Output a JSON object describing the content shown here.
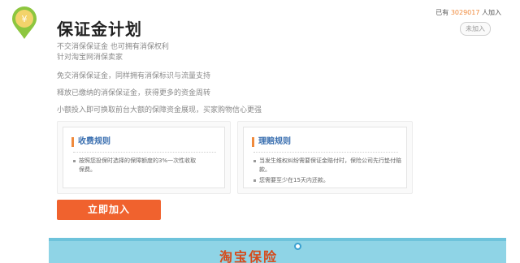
{
  "header": {
    "logo_symbol": "¥",
    "title": "保证金计划",
    "subtitle_lines": [
      "不交消保保证金 也可拥有消保权利",
      "针对淘宝网消保卖家"
    ],
    "join_count_prefix": "已有",
    "join_count": "3029017",
    "join_count_suffix": "人加入",
    "join_small_button": "未加入"
  },
  "benefits": [
    "免交消保保证金，同样拥有消保标识与流量支持",
    "释放已缴纳的消保保证金，获得更多的资金周转",
    "小额投入即可换取前台大额的保障资金展现，买家购物信心更强"
  ],
  "fee_rules": {
    "title": "收费规则",
    "items": [
      "按照您投保时选择的保障额度的3%一次性收取保费。"
    ]
  },
  "claim_rules": {
    "title": "理赔规则",
    "items": [
      "当发生维权纠纷需要保证金赔付时，保险公司先行垫付赔款。",
      "您需要至少在15天内还款。"
    ]
  },
  "join_button": "立即加入",
  "banner": {
    "text": "淘宝保险"
  },
  "colors": {
    "accent": "#f0622e",
    "logo_green": "#8dc63f",
    "banner": "#8fd4e6"
  }
}
